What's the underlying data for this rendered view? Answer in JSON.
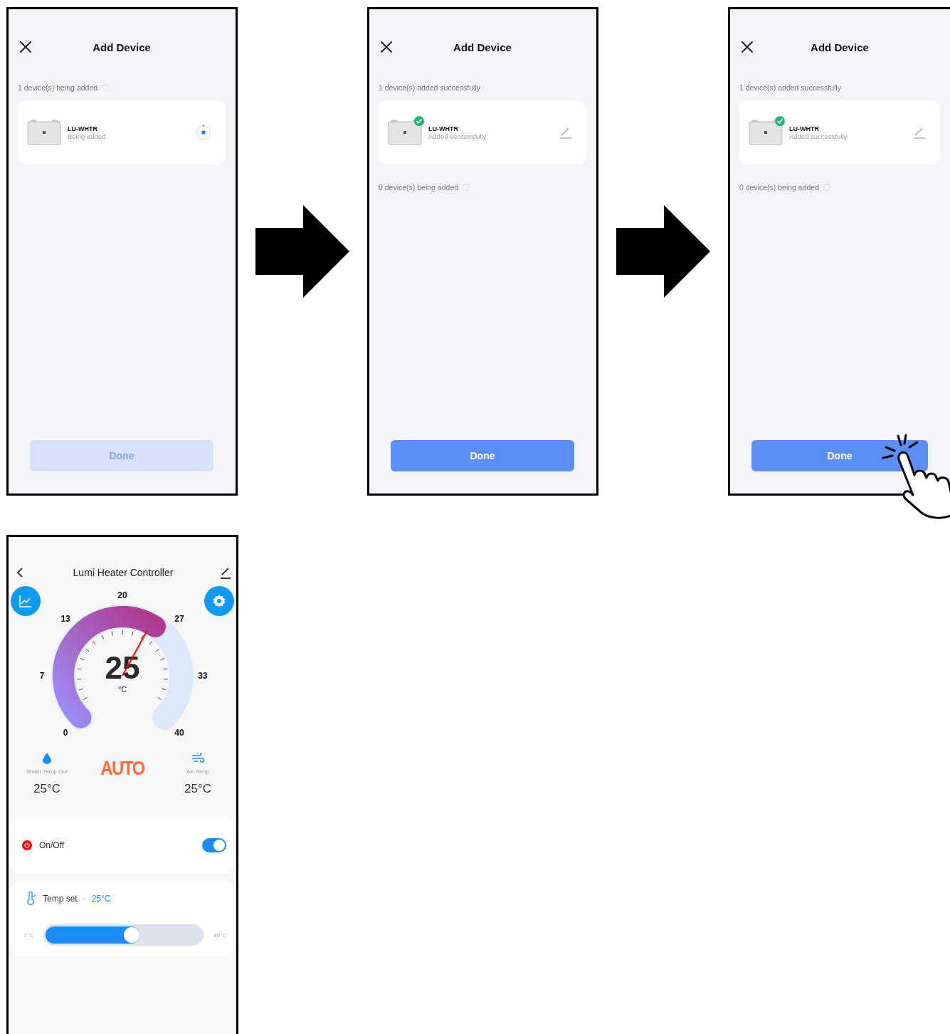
{
  "screens": [
    {
      "kind": "add_device",
      "title": "Add Device",
      "groups": [
        {
          "status": "1 device(s) being added",
          "loading": true,
          "devices": [
            {
              "name": "LU-WHTR",
              "status": "Being added",
              "added": false
            }
          ]
        }
      ],
      "done": {
        "label": "Done",
        "disabled": true
      }
    },
    {
      "kind": "add_device",
      "title": "Add Device",
      "groups": [
        {
          "status": "1 device(s) added successfully",
          "devices": [
            {
              "name": "LU-WHTR",
              "status": "Added successfully",
              "added": true
            }
          ]
        },
        {
          "status": "0 device(s) being added",
          "loading": true
        }
      ],
      "done": {
        "label": "Done",
        "disabled": false
      }
    },
    {
      "kind": "add_device",
      "title": "Add Device",
      "groups": [
        {
          "status": "1 device(s) added successfully",
          "devices": [
            {
              "name": "LU-WHTR",
              "status": "Added successfully",
              "added": true
            }
          ]
        },
        {
          "status": "0 device(s) being added",
          "loading": true
        }
      ],
      "done": {
        "label": "Done",
        "disabled": false,
        "tapped": true
      }
    },
    {
      "kind": "heater",
      "title": "Lumi Heater Controller",
      "gauge": {
        "scale": [
          "0",
          "7",
          "13",
          "20",
          "27",
          "33",
          "40"
        ],
        "value": "25",
        "unit": "°C",
        "level": 0.625
      },
      "mode": "AUTO",
      "readings": [
        {
          "kind": "water",
          "label": "Water Temp Out",
          "value": "25°C"
        },
        {
          "kind": "air",
          "label": "Air-Temp",
          "value": "25°C"
        }
      ],
      "power": {
        "label": "On/Off",
        "on": true
      },
      "temp_set": {
        "label": "Temp set",
        "separator": "·",
        "value": "25°C",
        "min": "1°C",
        "max": "40°C",
        "level": 0.6
      }
    }
  ]
}
